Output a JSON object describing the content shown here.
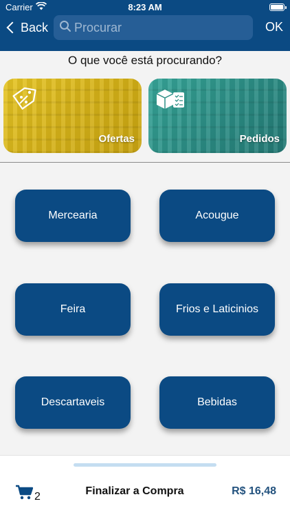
{
  "status_bar": {
    "carrier": "Carrier",
    "time": "8:23 AM"
  },
  "nav": {
    "back_label": "Back",
    "search_placeholder": "Procurar",
    "ok_label": "OK"
  },
  "question": "O que você está procurando?",
  "promos": [
    {
      "label": "Ofertas",
      "icon": "tag-percent-icon",
      "color": "#e1bf22"
    },
    {
      "label": "Pedidos",
      "icon": "box-checklist-icon",
      "color": "#2f9a8e"
    }
  ],
  "categories": [
    "Mercearia",
    "Acougue",
    "Feira",
    "Frios e Laticinios",
    "Descartaveis",
    "Bebidas"
  ],
  "footer": {
    "cart_count": "2",
    "finalize_label": "Finalizar a Compra",
    "total": "R$ 16,48"
  },
  "colors": {
    "primary": "#0b4a83",
    "background": "#f3f3f3",
    "total_text": "#23527e"
  }
}
